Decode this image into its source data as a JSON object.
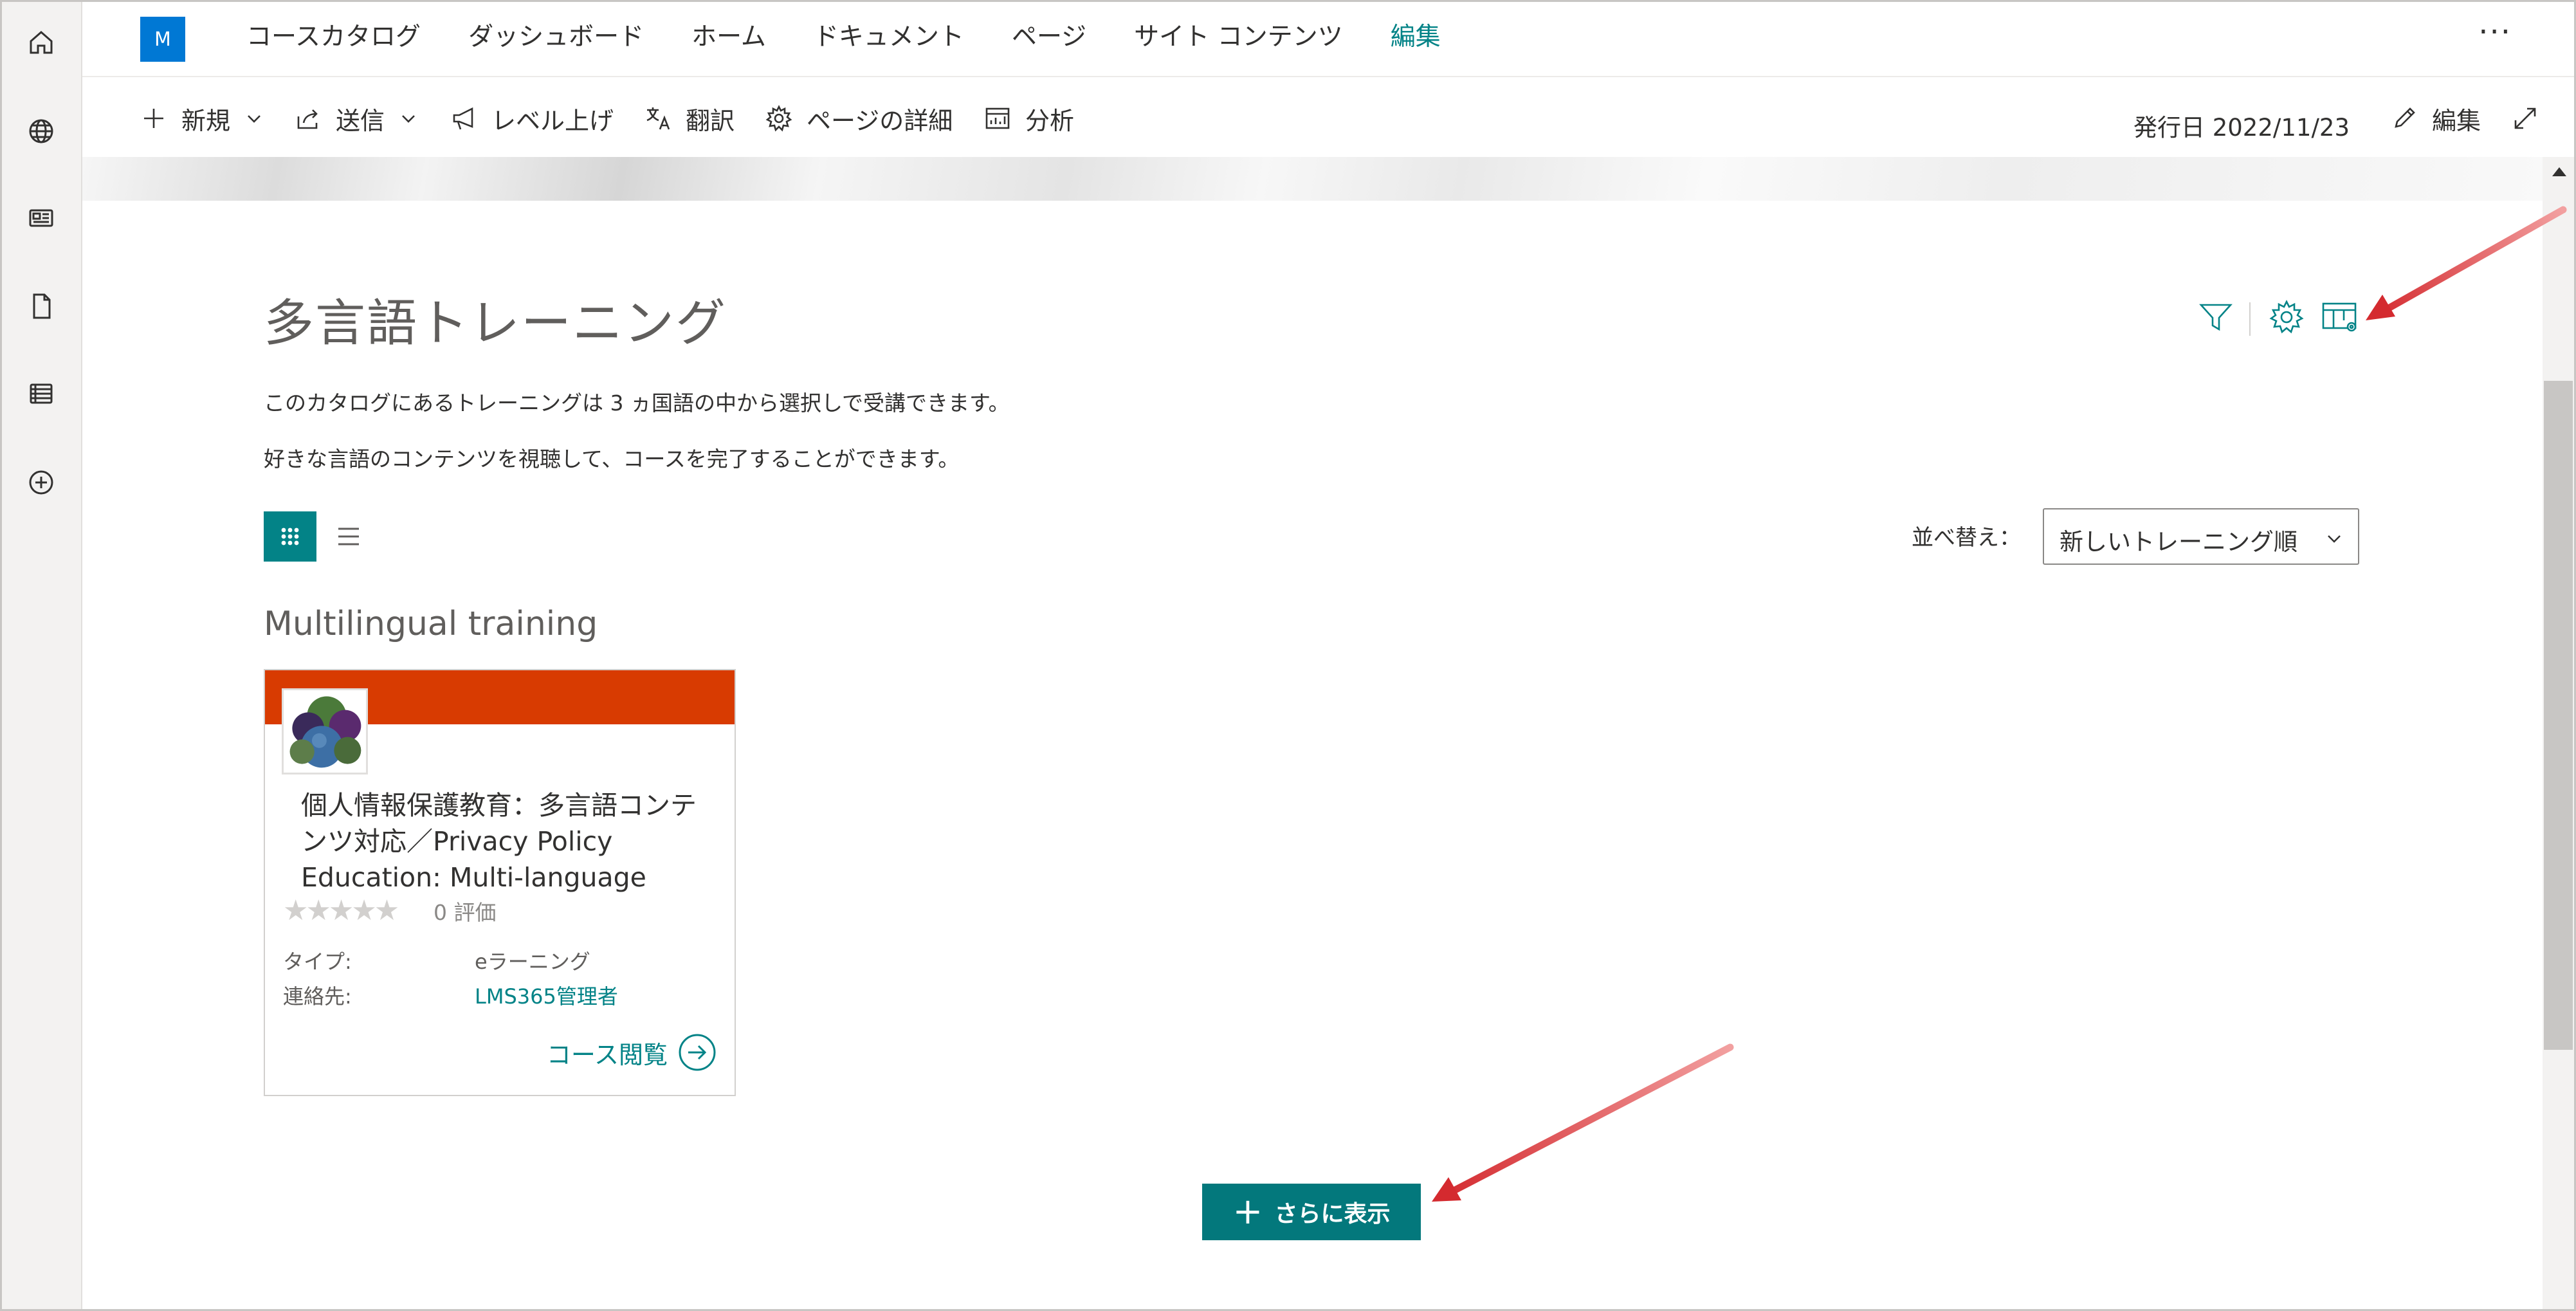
{
  "appbar": {
    "items": [
      "home-icon",
      "globe-icon",
      "news-icon",
      "document-icon",
      "list-icon",
      "add-icon"
    ]
  },
  "site": {
    "logo_letter": "M",
    "nav": [
      "コースカタログ",
      "ダッシュボード",
      "ホーム",
      "ドキュメント",
      "ページ",
      "サイト コンテンツ",
      "編集"
    ],
    "more": "···"
  },
  "commandbar": {
    "new": "新規",
    "send": "送信",
    "promote": "レベル上げ",
    "translate": "翻訳",
    "page_details": "ページの詳細",
    "analytics": "分析",
    "published": "発行日 2022/11/23",
    "edit": "編集"
  },
  "webpart": {
    "title": "多言語トレーニング",
    "desc1": "このカタログにあるトレーニングは 3 ヵ国語の中から選択しで受講できます。",
    "desc2": "好きな言語のコンテンツを視聴して、コースを完了することができます。",
    "sort_label": "並べ替え：",
    "sort_value": "新しいトレーニング順",
    "group_title": "Multilingual training",
    "show_more": "さらに表示"
  },
  "course": {
    "name": "個人情報保護教育：多言語コンテンツ対応／Privacy Policy Education: Multi-language",
    "stars": "★★★★★",
    "rating": "0 評価",
    "type_label": "タイプ:",
    "type_value": "eラーニング",
    "contact_label": "連絡先:",
    "contact_value": "LMS365管理者",
    "browse": "コース閲覧",
    "band_color": "#d83b01"
  },
  "colors": {
    "accent": "#038387",
    "annotation": "#e0282e"
  }
}
